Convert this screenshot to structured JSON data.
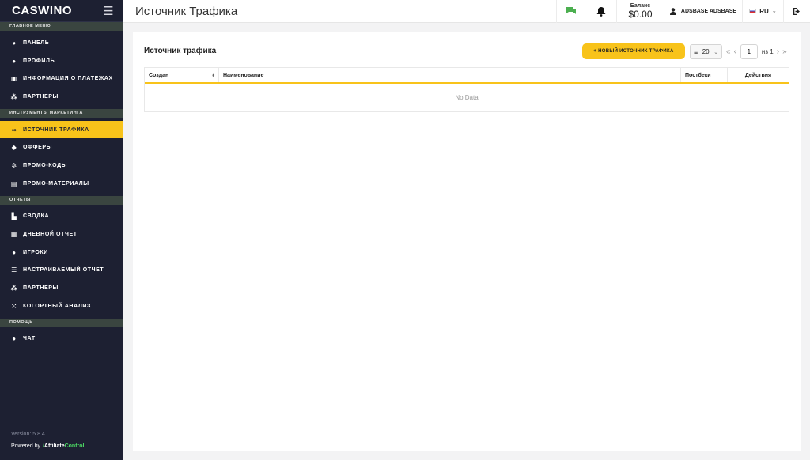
{
  "brand": {
    "logo_text": "CASWINO",
    "menu_icon": "hamburger-icon"
  },
  "sidebar": {
    "sections": [
      {
        "title": "ГЛАВНОЕ МЕНЮ",
        "items": [
          {
            "label": "ПАНЕЛЬ",
            "icon": "dashboard-icon"
          },
          {
            "label": "ПРОФИЛЬ",
            "icon": "user-icon"
          },
          {
            "label": "ИНФОРМАЦИЯ О ПЛАТЕЖАХ",
            "icon": "money-icon"
          },
          {
            "label": "ПАРТНЕРЫ",
            "icon": "users-icon"
          }
        ]
      },
      {
        "title": "ИНСТРУМЕНТЫ МАРКЕТИНГА",
        "items": [
          {
            "label": "ИСТОЧНИК ТРАФИКА",
            "icon": "link-icon",
            "active": true
          },
          {
            "label": "ОФФЕРЫ",
            "icon": "tag-icon"
          },
          {
            "label": "ПРОМО-КОДЫ",
            "icon": "promo-icon"
          },
          {
            "label": "ПРОМО-МАТЕРИАЛЫ",
            "icon": "images-icon"
          }
        ]
      },
      {
        "title": "ОТЧЕТЫ",
        "items": [
          {
            "label": "СВОДКА",
            "icon": "chart-icon"
          },
          {
            "label": "ДНЕВНОЙ ОТЧЕТ",
            "icon": "calendar-icon"
          },
          {
            "label": "ИГРОКИ",
            "icon": "user-icon"
          },
          {
            "label": "НАСТРАИВАЕМЫЙ ОТЧЕТ",
            "icon": "sliders-icon"
          },
          {
            "label": "ПАРТНЕРЫ",
            "icon": "users-icon"
          },
          {
            "label": "КОГОРТНЫЙ АНАЛИЗ",
            "icon": "group-icon"
          }
        ]
      },
      {
        "title": "ПОМОЩЬ",
        "items": [
          {
            "label": "ЧАТ",
            "icon": "chat-icon"
          }
        ]
      }
    ],
    "version": "Version: 5.8.4",
    "powered_by": "Powered by",
    "powered_brand_1": "Affiliate",
    "powered_brand_2": "Control"
  },
  "header": {
    "title": "Источник Трафика",
    "balance_label": "Баланс",
    "balance_value": "$0.00",
    "user_name": "ADSBASE ADSBASE",
    "language": "RU"
  },
  "main": {
    "card_title": "Источник трафика",
    "new_button": "+ НОВЫЙ ИСТОЧНИК ТРАФИКА",
    "page_size": "20",
    "page_current": "1",
    "page_of": "из 1",
    "columns": [
      "Создан",
      "Наименование",
      "Постбеки",
      "Действия"
    ],
    "empty_text": "No Data"
  },
  "colors": {
    "accent": "#f8c31a",
    "sidebar_bg": "#1d2032",
    "section_bg": "#3a4540",
    "chat_green": "#4caf50"
  }
}
